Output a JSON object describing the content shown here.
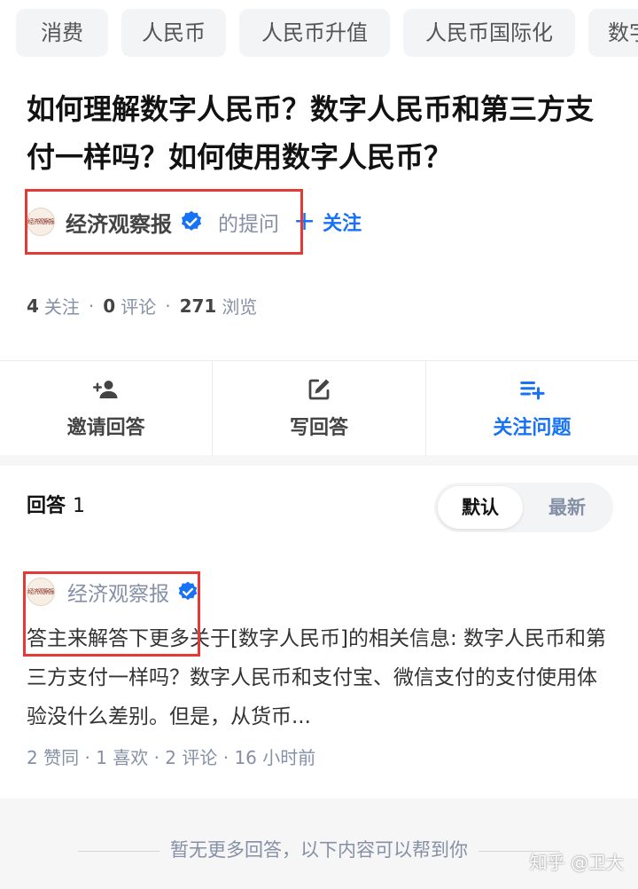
{
  "topics": [
    "消费",
    "人民币",
    "人民币升值",
    "人民币国际化",
    "数字"
  ],
  "question": {
    "title": "如何理解数字人民币？数字人民币和第三方支付一样吗？如何使用数字人民币？"
  },
  "asker": {
    "logo_text": "经济观察报",
    "name": "经济观察报",
    "suffix": "的提问",
    "follow_label": "关注"
  },
  "stats": {
    "follows_count": "4",
    "follows_label": "关注",
    "comments_count": "0",
    "comments_label": "评论",
    "views_count": "271",
    "views_label": "浏览",
    "separator": "·"
  },
  "actions": [
    {
      "label": "邀请回答",
      "icon": "invite-user-icon"
    },
    {
      "label": "写回答",
      "icon": "edit-icon"
    },
    {
      "label": "关注问题",
      "icon": "playlist-add-icon"
    }
  ],
  "answers_header": {
    "label": "回答",
    "count": "1"
  },
  "sort": {
    "default": "默认",
    "latest": "最新",
    "selected": "默认"
  },
  "answer": {
    "author": "经济观察报",
    "excerpt": "答主来解答下更多关于[数字人民币]的相关信息: 数字人民币和第三方支付一样吗？数字人民币和支付宝、微信支付的支付使用体验没什么差别。但是，从货币...",
    "meta": "2 赞同 · 1 喜欢 · 2 评论 · 16 小时前"
  },
  "footer": {
    "no_more": "暂无更多回答，以下内容可以帮到你",
    "watermark": "知乎 @卫大"
  },
  "colors": {
    "accent": "#1772f6",
    "highlight_box": "#e53935",
    "muted": "#8590a6"
  }
}
